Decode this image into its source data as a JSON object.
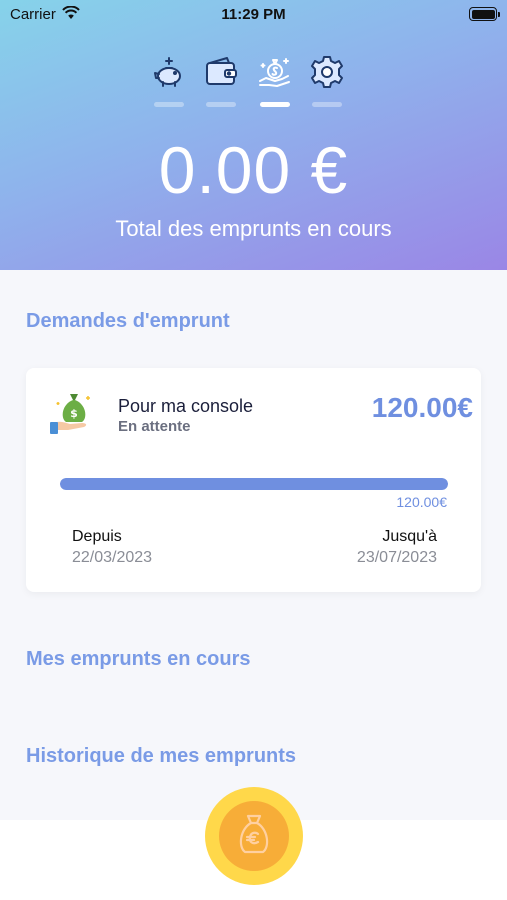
{
  "status_bar": {
    "carrier": "Carrier",
    "time": "11:29 PM"
  },
  "tabs": [
    {
      "icon": "piggy-bank-icon",
      "active": false
    },
    {
      "icon": "wallet-icon",
      "active": false
    },
    {
      "icon": "hand-money-bag-icon",
      "active": true
    },
    {
      "icon": "gear-icon",
      "active": false
    }
  ],
  "summary": {
    "total_amount": "0.00 €",
    "total_label": "Total des emprunts en cours"
  },
  "sections": {
    "requests_title": "Demandes d'emprunt",
    "current_title": "Mes emprunts en cours",
    "history_title": "Historique de mes emprunts"
  },
  "request_card": {
    "title": "Pour ma console",
    "status": "En attente",
    "amount": "120.00€",
    "progress_label": "120.00€",
    "progress_fraction": 1.0,
    "since_label": "Depuis",
    "since_date": "22/03/2023",
    "until_label": "Jusqu'à",
    "until_date": "23/07/2023"
  },
  "colors": {
    "accent": "#6f8fe0",
    "fab_outer": "#ffd84a",
    "fab_inner": "#f7ad38"
  },
  "fab": {
    "icon": "euro-money-bag-icon"
  }
}
